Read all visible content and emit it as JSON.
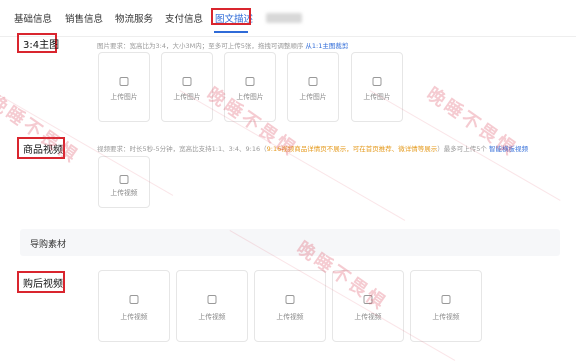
{
  "tabs": [
    {
      "label": "基础信息"
    },
    {
      "label": "销售信息"
    },
    {
      "label": "物流服务"
    },
    {
      "label": "支付信息"
    },
    {
      "label": "图文描述"
    }
  ],
  "sections": {
    "main_image": {
      "title": "3:4主图",
      "hint": "图片要求：宽高比为3:4，大小3M内；至多可上传5张，拖拽可调整顺序",
      "hint_link": "从1:1主图裁剪",
      "slot_label": "上传图片"
    },
    "product_video": {
      "title": "商品视频",
      "hint_prefix": "视频要求：时长5秒-5分钟，宽高比支持1:1、3:4、9:16（",
      "hint_orange": "9:16视频商品详情页不展示，可在首页推荐、微详情等展示",
      "hint_suffix": "）最多可上传5个",
      "hint_link": "智能横板视频",
      "slot_label": "上传视频"
    },
    "guide": {
      "title": "导购素材"
    },
    "after_video": {
      "title": "购后视频",
      "slot_label": "上传视频"
    }
  },
  "watermark": {
    "text": "晚睡不畏惧"
  }
}
